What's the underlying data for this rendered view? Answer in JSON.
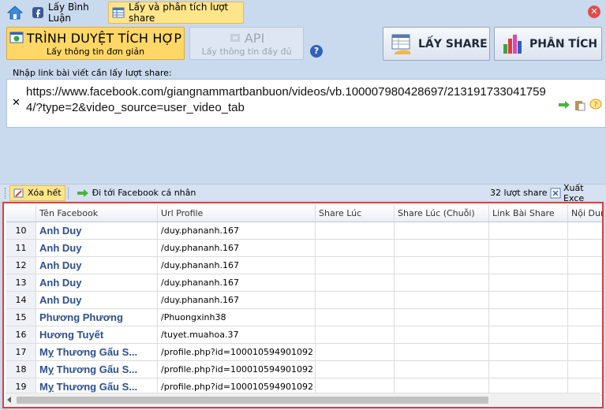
{
  "tabs": [
    {
      "label": "Lấy Bình Luận"
    },
    {
      "label": "Lấy và phân tích lượt share"
    }
  ],
  "modes": {
    "browser": {
      "title": "TRÌNH DUYỆT TÍCH HỢP",
      "subtitle": "Lấy thông tin đơn giản"
    },
    "api": {
      "title": "API",
      "subtitle": "Lấy thông tin đầy đủ"
    }
  },
  "actions": {
    "get_share": "LẤY SHARE",
    "analyze": "PHÂN TÍCH"
  },
  "input": {
    "label": "Nhập link bài viết cần lấy lượt share:",
    "value": "https://www.facebook.com/giangnammartbanbuon/videos/vb.100007980428697/2131917330417594/?type=2&video_source=user_video_tab"
  },
  "toolbar": {
    "clear_all": "Xóa hết",
    "goto_profile": "Đi tới Facebook cá nhân",
    "count": "32 lượt share",
    "export": "Xuất Exce"
  },
  "table": {
    "columns": [
      "",
      "Tên Facebook",
      "Url Profile",
      "Share Lúc",
      "Share Lúc (Chuỗi)",
      "Link Bài Share",
      "Nội Dun"
    ],
    "rows": [
      {
        "no": "10",
        "name": "Anh Duy",
        "url": "/duy.phananh.167"
      },
      {
        "no": "11",
        "name": "Anh Duy",
        "url": "/duy.phananh.167"
      },
      {
        "no": "12",
        "name": "Anh Duy",
        "url": "/duy.phananh.167"
      },
      {
        "no": "13",
        "name": "Anh Duy",
        "url": "/duy.phananh.167"
      },
      {
        "no": "14",
        "name": "Anh Duy",
        "url": "/duy.phananh.167"
      },
      {
        "no": "15",
        "name": "Phương Phương",
        "url": "/Phuongxinh38"
      },
      {
        "no": "16",
        "name": "Hương Tuyết",
        "url": "/tuyet.muahoa.37"
      },
      {
        "no": "17",
        "name": "Mỵ Thương Gấu S...",
        "url": "/profile.php?id=100010594901092"
      },
      {
        "no": "18",
        "name": "Mỵ Thương Gấu S...",
        "url": "/profile.php?id=100010594901092"
      },
      {
        "no": "19",
        "name": "Mỵ Thương Gấu S...",
        "url": "/profile.php?id=100010594901092"
      }
    ]
  },
  "colors": {
    "accent": "#ffd766",
    "highlight_border": "#e23c3c",
    "name_text": "#2c4f8e"
  }
}
